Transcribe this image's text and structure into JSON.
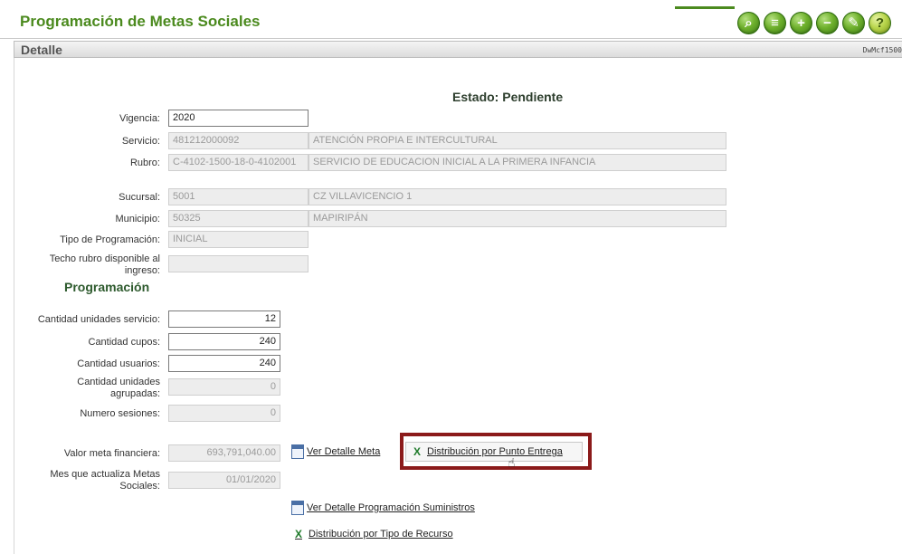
{
  "header": {
    "app_title": "Programación de Metas Sociales",
    "toolbar": [
      {
        "name": "search-icon",
        "glyph": "⌕"
      },
      {
        "name": "list-icon",
        "glyph": "≡"
      },
      {
        "name": "add-icon",
        "glyph": "+"
      },
      {
        "name": "remove-icon",
        "glyph": "−"
      },
      {
        "name": "edit-icon",
        "glyph": "✎"
      },
      {
        "name": "help-icon",
        "glyph": "?"
      }
    ]
  },
  "section": {
    "title": "Detalle",
    "code": "DwMcf1500"
  },
  "estado": "Estado: Pendiente",
  "fields": {
    "vigencia": {
      "label": "Vigencia:",
      "value": "2020"
    },
    "servicio": {
      "label": "Servicio:",
      "code": "481212000092",
      "desc": "ATENCIÓN PROPIA E INTERCULTURAL"
    },
    "rubro": {
      "label": "Rubro:",
      "code": "C-4102-1500-18-0-4102001",
      "desc": "SERVICIO DE EDUCACION INICIAL A LA PRIMERA INFANCIA"
    },
    "sucursal": {
      "label": "Sucursal:",
      "code": "5001",
      "desc": "CZ VILLAVICENCIO 1"
    },
    "municipio": {
      "label": "Municipio:",
      "code": "50325",
      "desc": "MAPIRIPÁN"
    },
    "tipo_programacion": {
      "label": "Tipo de Programación:",
      "value": "INICIAL"
    },
    "techo_rubro": {
      "label_line1": "Techo rubro disponible al",
      "label_line2": "ingreso:",
      "value": ""
    }
  },
  "programacion": {
    "title": "Programación",
    "cantidad_unidades_servicio": {
      "label": "Cantidad unidades servicio:",
      "value": "12"
    },
    "cantidad_cupos": {
      "label": "Cantidad cupos:",
      "value": "240"
    },
    "cantidad_usuarios": {
      "label": "Cantidad usuarios:",
      "value": "240"
    },
    "cantidad_unidades_agrupadas": {
      "label_line1": "Cantidad unidades",
      "label_line2": "agrupadas:",
      "value": "0"
    },
    "numero_sesiones": {
      "label": "Numero sesiones:",
      "value": "0"
    },
    "valor_meta_financiera": {
      "label": "Valor meta financiera:",
      "value": "693,791,040.00"
    },
    "mes_actualiza": {
      "label_line1": "Mes que actualiza Metas",
      "label_line2": "Sociales:",
      "value": "01/01/2020"
    }
  },
  "actions": {
    "ver_detalle_meta": "Ver Detalle Meta",
    "distribucion_punto_entrega": "Distribución por Punto Entrega",
    "ver_detalle_suministros": "Ver Detalle Programación Suministros",
    "distribucion_tipo_recurso": "Distribución por Tipo de Recurso"
  },
  "colors": {
    "title_green": "#4b8a1e",
    "highlight_red": "#8b1a1a"
  }
}
